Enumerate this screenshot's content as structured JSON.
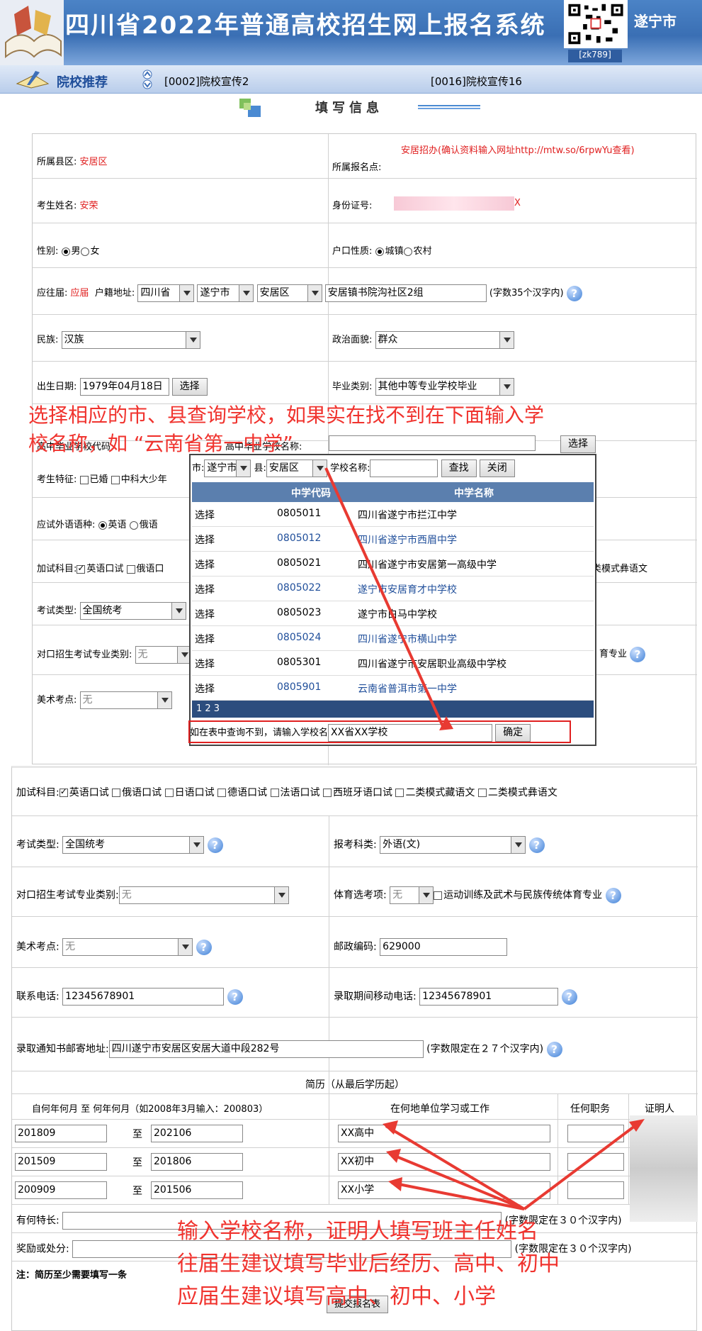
{
  "banner": {
    "title": "四川省2022年普通高校招生网上报名系统",
    "qr_tag": "[zk789]",
    "city": "遂宁市"
  },
  "nav": {
    "label": "院校推荐",
    "ad1": "[0002]院校宣传2",
    "ad2": "[0016]院校宣传16"
  },
  "section_title": "填写信息",
  "form_top": {
    "county_label": "所属县区:",
    "county": "安居区",
    "site_label": "所属报名点:",
    "site": "安居招办(确认资料输入网址http://mtw.so/6rpwYu查看)",
    "name_label": "考生姓名:",
    "name": "安荣",
    "id_label": "身份证号:",
    "id_tail": "X",
    "gender_label": "性别:",
    "male": "男",
    "female": "女",
    "hukou_label": "户口性质:",
    "urban": "城镇",
    "rural": "农村",
    "grad_label": "应往届:",
    "grad": "应届",
    "addr_label": "户籍地址:",
    "prov": "四川省",
    "city": "遂宁市",
    "dist": "安居区",
    "addr": "安居镇书院沟社区2组",
    "addr_note": "(字数35个汉字内)",
    "nation_label": "民族:",
    "nation": "汉族",
    "political_label": "政治面貌:",
    "political": "群众",
    "birth_label": "出生日期:",
    "birth": "1979年04月18日",
    "choose": "选择",
    "gradtype_label": "毕业类别:",
    "gradtype": "其他中等专业学校毕业",
    "school_code_label": "高中毕业学校代码:",
    "school_name_label": "高中毕业学校名称:",
    "choose2": "选择",
    "feature_label": "考生特征:",
    "married": "已婚",
    "cas": "中科大少年",
    "lang_label": "应试外语语种:",
    "en": "英语",
    "ru": "俄语",
    "extra_label": "加试科目:",
    "oral": "英语口试",
    "ru_oral": "俄语口",
    "yi": "类模式彝语文",
    "examtype_label": "考试类型:",
    "examtype": "全国统考",
    "duikou_label": "对口招生考试专业类别:",
    "duikou": "无",
    "pe_short": "育专业",
    "art_label": "美术考点:",
    "art": "无"
  },
  "overlay_top": {
    "line1": "选择相应的市、县查询学校，如果实在找不到在下面输入学",
    "line2": "校名称，如 “云南省第一中学”"
  },
  "popup": {
    "city_label": "市:",
    "city": "遂宁市",
    "county_label": "县:",
    "county": "安居区",
    "school_label": "学校名称:",
    "find": "查找",
    "close": "关闭",
    "col_code": "中学代码",
    "col_name": "中学名称",
    "rows": [
      {
        "sel": "选择",
        "code": "0805011",
        "name": "四川省遂宁市拦江中学"
      },
      {
        "sel": "选择",
        "code": "0805012",
        "name": "四川省遂宁市西眉中学"
      },
      {
        "sel": "选择",
        "code": "0805021",
        "name": "四川省遂宁市安居第一高级中学"
      },
      {
        "sel": "选择",
        "code": "0805022",
        "name": "遂宁市安居育才中学校"
      },
      {
        "sel": "选择",
        "code": "0805023",
        "name": "遂宁市白马中学校"
      },
      {
        "sel": "选择",
        "code": "0805024",
        "name": "四川省遂宁市横山中学"
      },
      {
        "sel": "选择",
        "code": "0805301",
        "name": "四川省遂宁市安居职业高级中学校"
      },
      {
        "sel": "选择",
        "code": "0805901",
        "name": "云南省普洱市第一中学"
      }
    ],
    "pages": "1 2 3",
    "bottom_label": "如在表中查询不到，请输入学校名",
    "bottom_value": "XX省XX学校",
    "confirm": "确定"
  },
  "form_bottom": {
    "extra_label": "加试科目:",
    "opts": [
      "英语口试",
      "俄语口试",
      "日语口试",
      "德语口试",
      "法语口试",
      "西班牙语口试",
      "二类模式藏语文",
      "二类模式彝语文"
    ],
    "examtype_label": "考试类型:",
    "examtype": "全国统考",
    "subject_label": "报考科类:",
    "subject": "外语(文)",
    "duikou_label": "对口招生考试专业类别:",
    "duikou": "无",
    "pe_label": "体育选考项:",
    "pe": "无",
    "pe_chk": "运动训练及武术与民族传统体育专业",
    "art_label": "美术考点:",
    "art": "无",
    "zip_label": "邮政编码:",
    "zip": "629000",
    "phone_label": "联系电话:",
    "phone": "12345678901",
    "mobile_label": "录取期间移动电话:",
    "mobile": "12345678901",
    "mail_label": "录取通知书邮寄地址:",
    "mail": "四川遂宁市安居区安居大道中段282号",
    "mail_note": "(字数限定在２７个汉字内)",
    "resume_title": "简历（从最后学历起）",
    "col_time": "自何年何月 至 何年何月（如2008年3月输入：200803）",
    "col_unit": "在何地单位学习或工作",
    "col_post": "任何职务",
    "col_witness": "证明人",
    "resume": [
      {
        "from": "201809",
        "to_label": "至",
        "to": "202106",
        "unit": "XX高中"
      },
      {
        "from": "201509",
        "to_label": "至",
        "to": "201806",
        "unit": "XX初中"
      },
      {
        "from": "200909",
        "to_label": "至",
        "to": "201506",
        "unit": "XX小学"
      }
    ],
    "talent_label": "有何特长:",
    "talent_note": "(字数限定在３０个汉字内)",
    "reward_label": "奖励或处分:",
    "reward_note": "(字数限定在３０个汉字内)",
    "note": "注：简历至少需要填写一条",
    "submit": "提交报名表"
  },
  "overlay_bottom": {
    "line1": "输入学校名称，证明人填写班主任姓名",
    "line2": "往届生建议填写毕业后经历、高中、初中",
    "line3": "应届生建议填写高中、初中、小学"
  }
}
